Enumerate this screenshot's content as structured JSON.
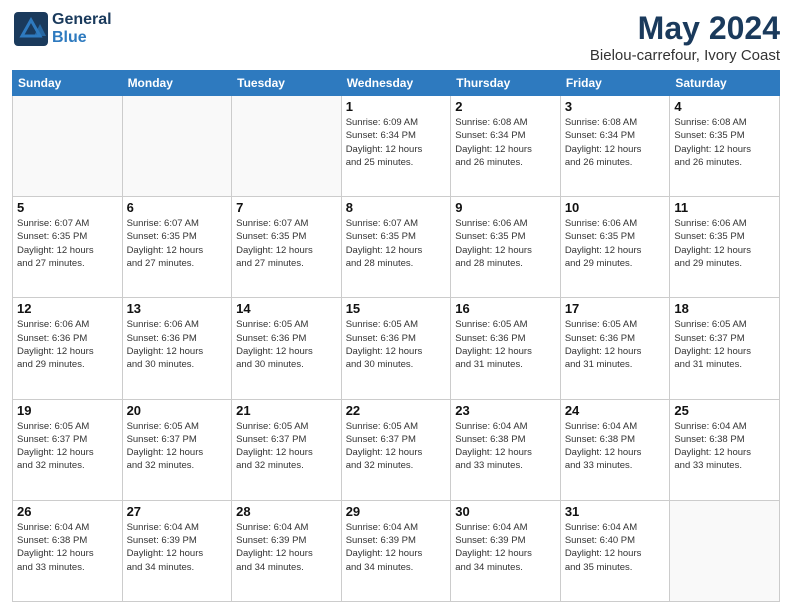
{
  "header": {
    "logo_line1": "General",
    "logo_line2": "Blue",
    "main_title": "May 2024",
    "subtitle": "Bielou-carrefour, Ivory Coast"
  },
  "weekdays": [
    "Sunday",
    "Monday",
    "Tuesday",
    "Wednesday",
    "Thursday",
    "Friday",
    "Saturday"
  ],
  "weeks": [
    [
      {
        "day": "",
        "info": ""
      },
      {
        "day": "",
        "info": ""
      },
      {
        "day": "",
        "info": ""
      },
      {
        "day": "1",
        "info": "Sunrise: 6:09 AM\nSunset: 6:34 PM\nDaylight: 12 hours\nand 25 minutes."
      },
      {
        "day": "2",
        "info": "Sunrise: 6:08 AM\nSunset: 6:34 PM\nDaylight: 12 hours\nand 26 minutes."
      },
      {
        "day": "3",
        "info": "Sunrise: 6:08 AM\nSunset: 6:34 PM\nDaylight: 12 hours\nand 26 minutes."
      },
      {
        "day": "4",
        "info": "Sunrise: 6:08 AM\nSunset: 6:35 PM\nDaylight: 12 hours\nand 26 minutes."
      }
    ],
    [
      {
        "day": "5",
        "info": "Sunrise: 6:07 AM\nSunset: 6:35 PM\nDaylight: 12 hours\nand 27 minutes."
      },
      {
        "day": "6",
        "info": "Sunrise: 6:07 AM\nSunset: 6:35 PM\nDaylight: 12 hours\nand 27 minutes."
      },
      {
        "day": "7",
        "info": "Sunrise: 6:07 AM\nSunset: 6:35 PM\nDaylight: 12 hours\nand 27 minutes."
      },
      {
        "day": "8",
        "info": "Sunrise: 6:07 AM\nSunset: 6:35 PM\nDaylight: 12 hours\nand 28 minutes."
      },
      {
        "day": "9",
        "info": "Sunrise: 6:06 AM\nSunset: 6:35 PM\nDaylight: 12 hours\nand 28 minutes."
      },
      {
        "day": "10",
        "info": "Sunrise: 6:06 AM\nSunset: 6:35 PM\nDaylight: 12 hours\nand 29 minutes."
      },
      {
        "day": "11",
        "info": "Sunrise: 6:06 AM\nSunset: 6:35 PM\nDaylight: 12 hours\nand 29 minutes."
      }
    ],
    [
      {
        "day": "12",
        "info": "Sunrise: 6:06 AM\nSunset: 6:36 PM\nDaylight: 12 hours\nand 29 minutes."
      },
      {
        "day": "13",
        "info": "Sunrise: 6:06 AM\nSunset: 6:36 PM\nDaylight: 12 hours\nand 30 minutes."
      },
      {
        "day": "14",
        "info": "Sunrise: 6:05 AM\nSunset: 6:36 PM\nDaylight: 12 hours\nand 30 minutes."
      },
      {
        "day": "15",
        "info": "Sunrise: 6:05 AM\nSunset: 6:36 PM\nDaylight: 12 hours\nand 30 minutes."
      },
      {
        "day": "16",
        "info": "Sunrise: 6:05 AM\nSunset: 6:36 PM\nDaylight: 12 hours\nand 31 minutes."
      },
      {
        "day": "17",
        "info": "Sunrise: 6:05 AM\nSunset: 6:36 PM\nDaylight: 12 hours\nand 31 minutes."
      },
      {
        "day": "18",
        "info": "Sunrise: 6:05 AM\nSunset: 6:37 PM\nDaylight: 12 hours\nand 31 minutes."
      }
    ],
    [
      {
        "day": "19",
        "info": "Sunrise: 6:05 AM\nSunset: 6:37 PM\nDaylight: 12 hours\nand 32 minutes."
      },
      {
        "day": "20",
        "info": "Sunrise: 6:05 AM\nSunset: 6:37 PM\nDaylight: 12 hours\nand 32 minutes."
      },
      {
        "day": "21",
        "info": "Sunrise: 6:05 AM\nSunset: 6:37 PM\nDaylight: 12 hours\nand 32 minutes."
      },
      {
        "day": "22",
        "info": "Sunrise: 6:05 AM\nSunset: 6:37 PM\nDaylight: 12 hours\nand 32 minutes."
      },
      {
        "day": "23",
        "info": "Sunrise: 6:04 AM\nSunset: 6:38 PM\nDaylight: 12 hours\nand 33 minutes."
      },
      {
        "day": "24",
        "info": "Sunrise: 6:04 AM\nSunset: 6:38 PM\nDaylight: 12 hours\nand 33 minutes."
      },
      {
        "day": "25",
        "info": "Sunrise: 6:04 AM\nSunset: 6:38 PM\nDaylight: 12 hours\nand 33 minutes."
      }
    ],
    [
      {
        "day": "26",
        "info": "Sunrise: 6:04 AM\nSunset: 6:38 PM\nDaylight: 12 hours\nand 33 minutes."
      },
      {
        "day": "27",
        "info": "Sunrise: 6:04 AM\nSunset: 6:39 PM\nDaylight: 12 hours\nand 34 minutes."
      },
      {
        "day": "28",
        "info": "Sunrise: 6:04 AM\nSunset: 6:39 PM\nDaylight: 12 hours\nand 34 minutes."
      },
      {
        "day": "29",
        "info": "Sunrise: 6:04 AM\nSunset: 6:39 PM\nDaylight: 12 hours\nand 34 minutes."
      },
      {
        "day": "30",
        "info": "Sunrise: 6:04 AM\nSunset: 6:39 PM\nDaylight: 12 hours\nand 34 minutes."
      },
      {
        "day": "31",
        "info": "Sunrise: 6:04 AM\nSunset: 6:40 PM\nDaylight: 12 hours\nand 35 minutes."
      },
      {
        "day": "",
        "info": ""
      }
    ]
  ]
}
